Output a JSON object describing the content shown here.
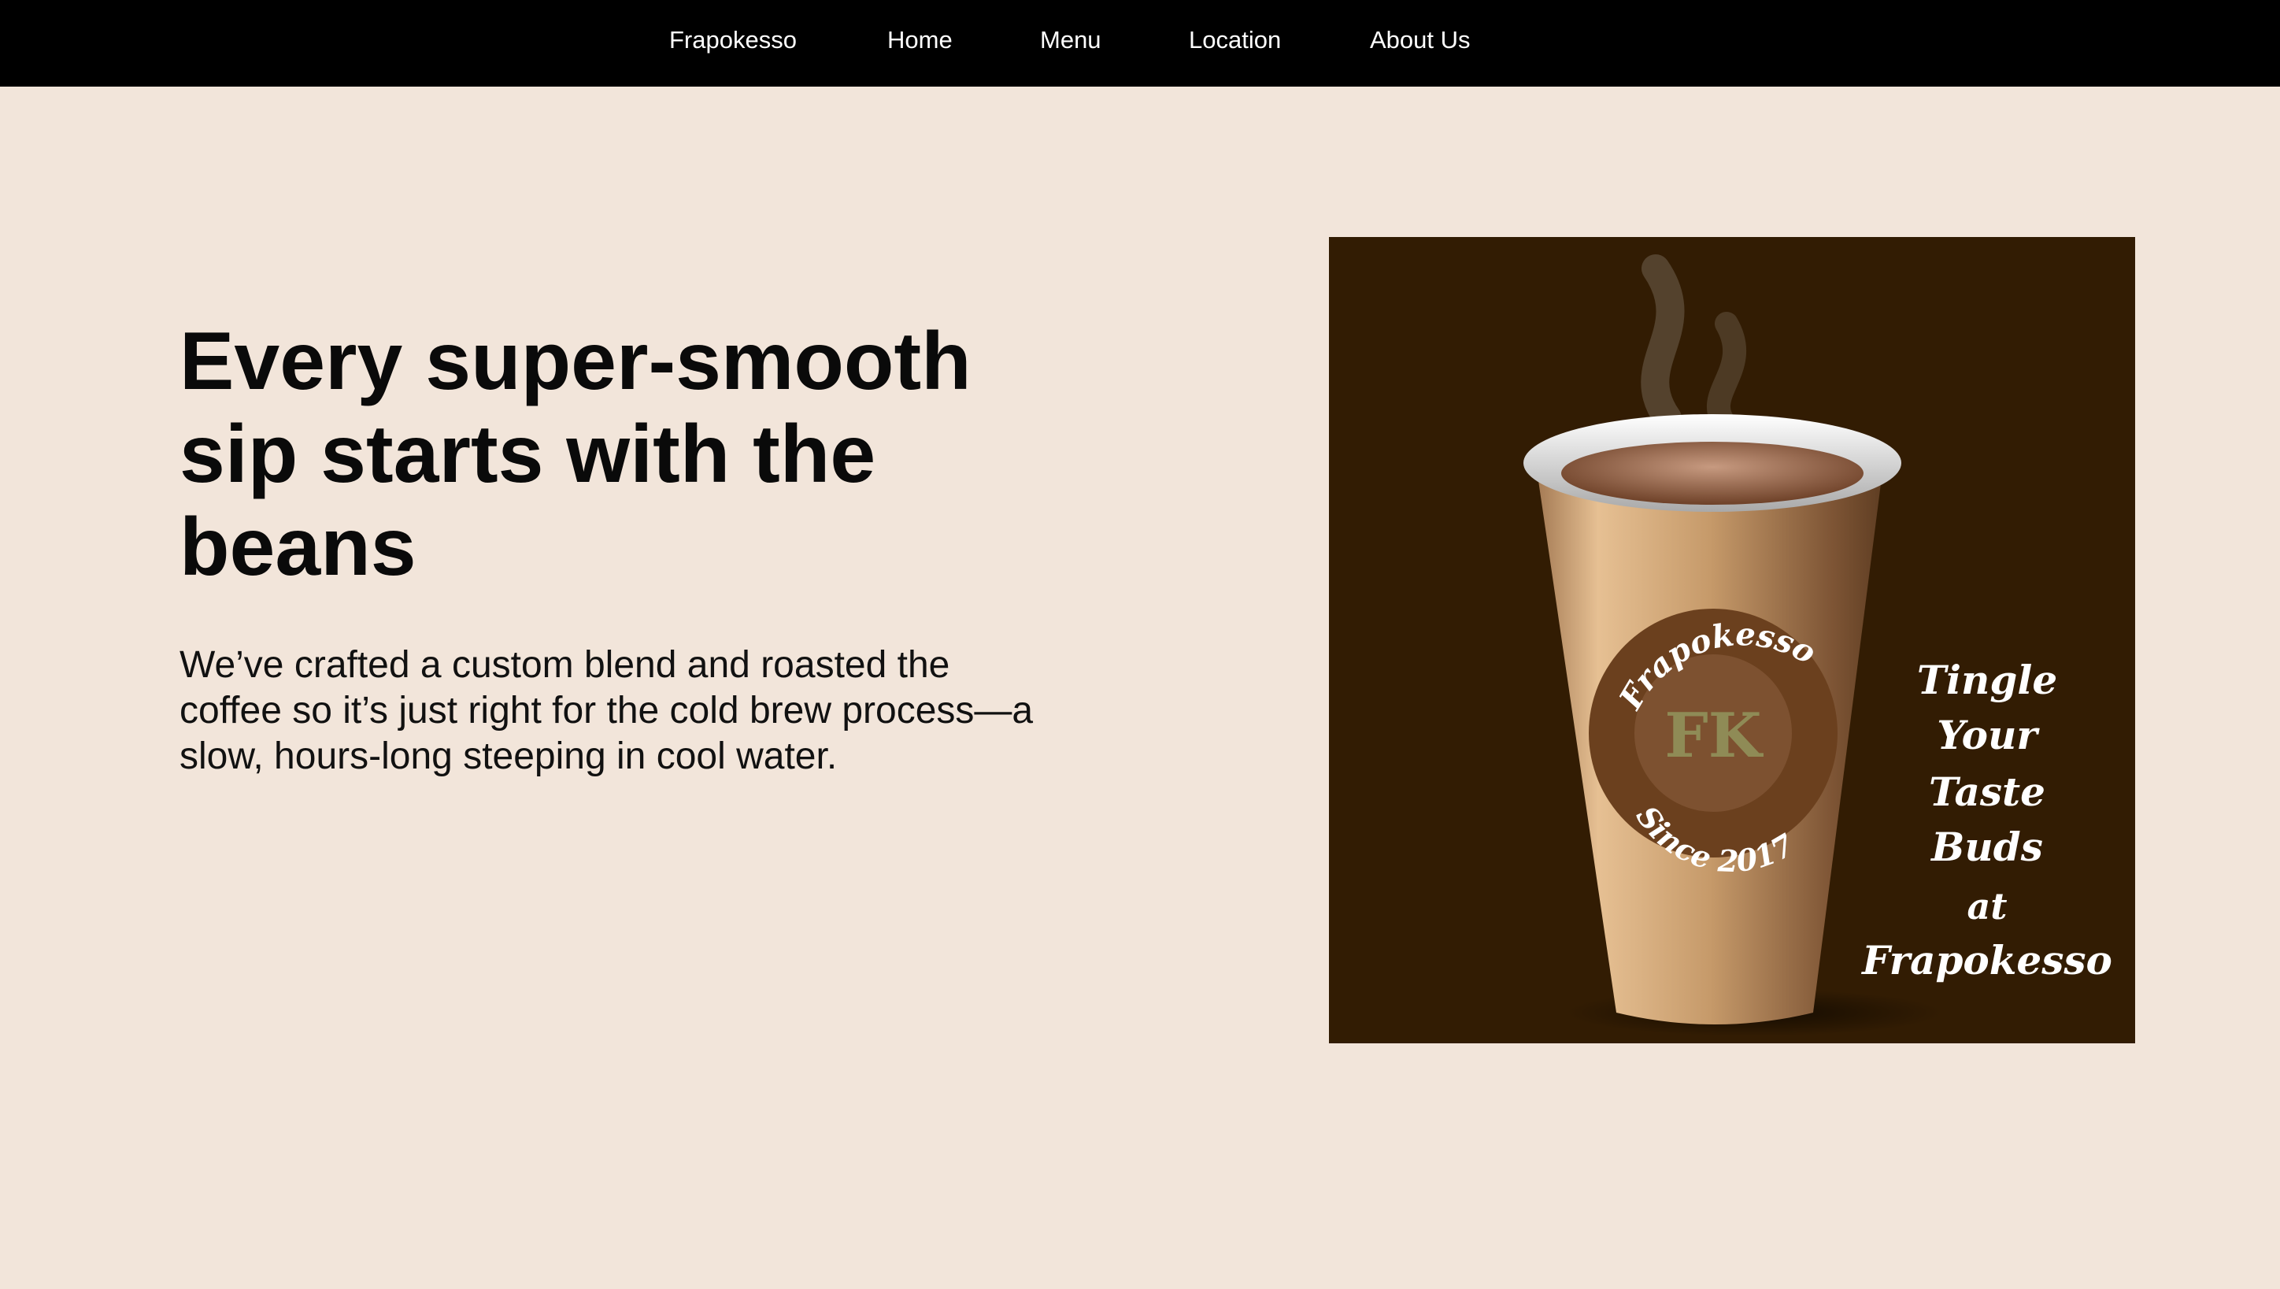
{
  "nav": {
    "items": [
      {
        "label": "Frapokesso"
      },
      {
        "label": "Home"
      },
      {
        "label": "Menu"
      },
      {
        "label": "Location"
      },
      {
        "label": "About Us"
      }
    ]
  },
  "hero": {
    "headline": "Every super-smooth sip starts with the beans",
    "body": "We’ve crafted a custom blend and roasted the coffee so it’s just right for the cold brew process—a slow, hours-long steeping in cool water."
  },
  "hero_image": {
    "badge_top_text": "Frapokesso",
    "badge_monogram": "FK",
    "badge_bottom_text": "Since 2017",
    "tagline_lines": [
      "Tingle",
      "Your",
      "Taste",
      "Buds",
      "at",
      "Frapokesso"
    ],
    "colors": {
      "background": "#321c03",
      "cup": "#c89d6e",
      "badge": "#6b401e",
      "monogram": "#8f8b56"
    }
  },
  "colors": {
    "page_background": "#f2e5da",
    "nav_background": "#000000",
    "nav_text": "#ffffff"
  }
}
